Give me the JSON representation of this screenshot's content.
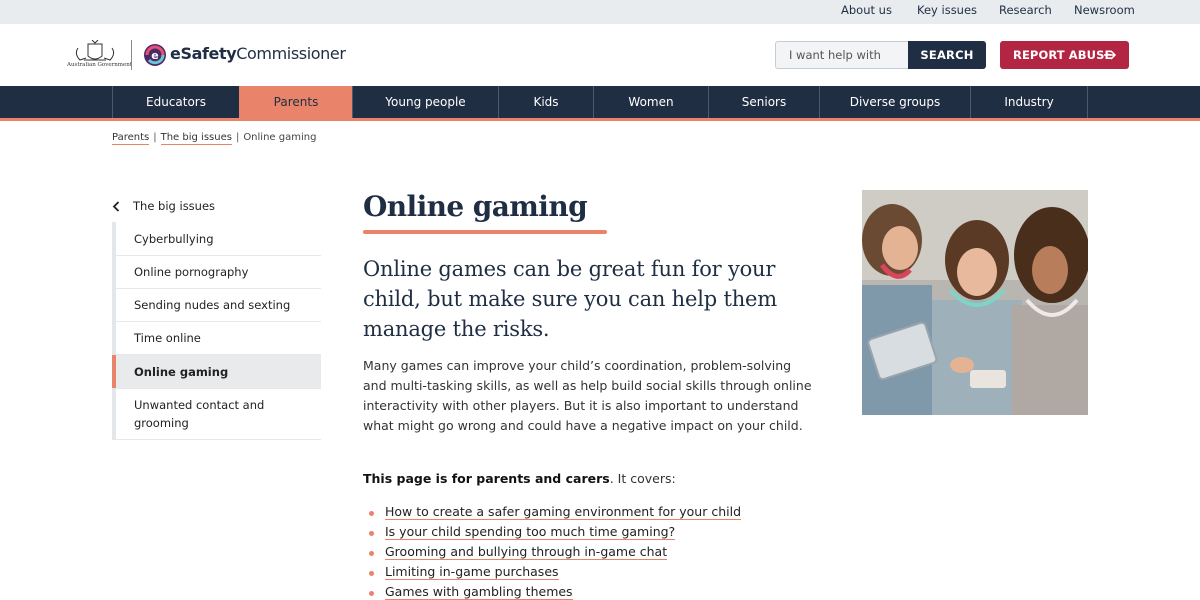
{
  "utility": {
    "links": [
      "About us",
      "Key issues",
      "Research",
      "Newsroom"
    ]
  },
  "header": {
    "gov_text": "Australian Government",
    "logo": {
      "bold": "eSafety",
      "regular": "Commissioner"
    },
    "search": {
      "placeholder": "I want help with",
      "button": "SEARCH"
    },
    "report_button": "REPORT ABUSE"
  },
  "nav": {
    "items": [
      {
        "label": "Educators",
        "active": false
      },
      {
        "label": "Parents",
        "active": true
      },
      {
        "label": "Young people",
        "active": false
      },
      {
        "label": "Kids",
        "active": false
      },
      {
        "label": "Women",
        "active": false
      },
      {
        "label": "Seniors",
        "active": false
      },
      {
        "label": "Diverse groups",
        "active": false
      },
      {
        "label": "Industry",
        "active": false
      }
    ]
  },
  "breadcrumb": {
    "items": [
      "Parents",
      "The big issues"
    ],
    "current": "Online gaming"
  },
  "sidenav": {
    "back_label": "The big issues",
    "items": [
      {
        "label": "Cyberbullying",
        "active": false
      },
      {
        "label": "Online pornography",
        "active": false
      },
      {
        "label": "Sending nudes and sexting",
        "active": false
      },
      {
        "label": "Time online",
        "active": false
      },
      {
        "label": "Online gaming",
        "active": true
      },
      {
        "label": "Unwanted contact and grooming",
        "active": false
      }
    ]
  },
  "content": {
    "title": "Online gaming",
    "intro": "Online games can be great fun for your child, but make sure you can help them manage the risks.",
    "body": "Many games can improve your child’s coordination, problem-solving and multi-tasking skills, as well as help build social skills through online interactivity with other players. But it is also important to understand what might go wrong and could have a negative impact on your child.",
    "covers_bold": "This page is for parents and carers",
    "covers_rest": ". It covers:",
    "toc": [
      "How to create a safer gaming environment for your child",
      "Is your child spending too much time gaming?",
      "Grooming and bullying through in-game chat",
      "Limiting in-game purchases",
      "Games with gambling themes"
    ]
  },
  "colors": {
    "navy": "#1f2e43",
    "accent": "#e9846a",
    "report": "#b32643"
  },
  "icons": {
    "crest": "australian-coat-of-arms-icon",
    "logo": "esafety-logo-icon",
    "report_arrow": "arrow-right-icon",
    "back": "chevron-left-icon"
  }
}
